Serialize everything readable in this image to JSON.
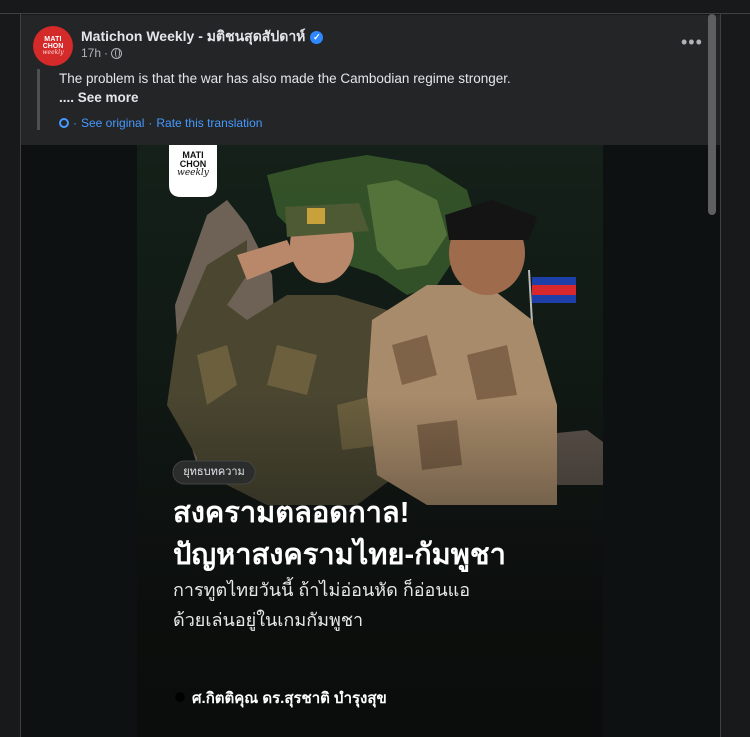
{
  "post": {
    "page_name": "Matichon Weekly - มติชนสุดสัปดาห์",
    "time": "17h",
    "separator": "·",
    "avatar": {
      "line1": "MATI",
      "line2": "CHON",
      "line3": "weekly"
    },
    "more_label": "•••"
  },
  "translation": {
    "text": "The problem is that the war has also made the Cambodian regime stronger.",
    "see_more": ".... See more",
    "see_original": "See original",
    "rate": "Rate this translation",
    "dot": "·"
  },
  "poster": {
    "logo": {
      "line1": "MATI",
      "line2": "CHON",
      "line3": "weekly"
    },
    "tag": "ยุทธบทความ",
    "headline1": "สงครามตลอดกาล!",
    "headline2": "ปัญหาสงครามไทย-กัมพูชา",
    "sub1": "การทูตไทยวันนี้ ถ้าไม่อ่อนหัด ก็อ่อนแอ",
    "sub2": "ด้วยเล่นอยู่ในเกมกัมพูชา",
    "author": "ศ.กิตติคุณ ดร.สุรชาติ บำรุงสุข"
  },
  "colors": {
    "brand_red": "#d42a2a",
    "link_blue": "#4599ff",
    "card_bg": "#242526",
    "verified_blue": "#2d88ff"
  }
}
